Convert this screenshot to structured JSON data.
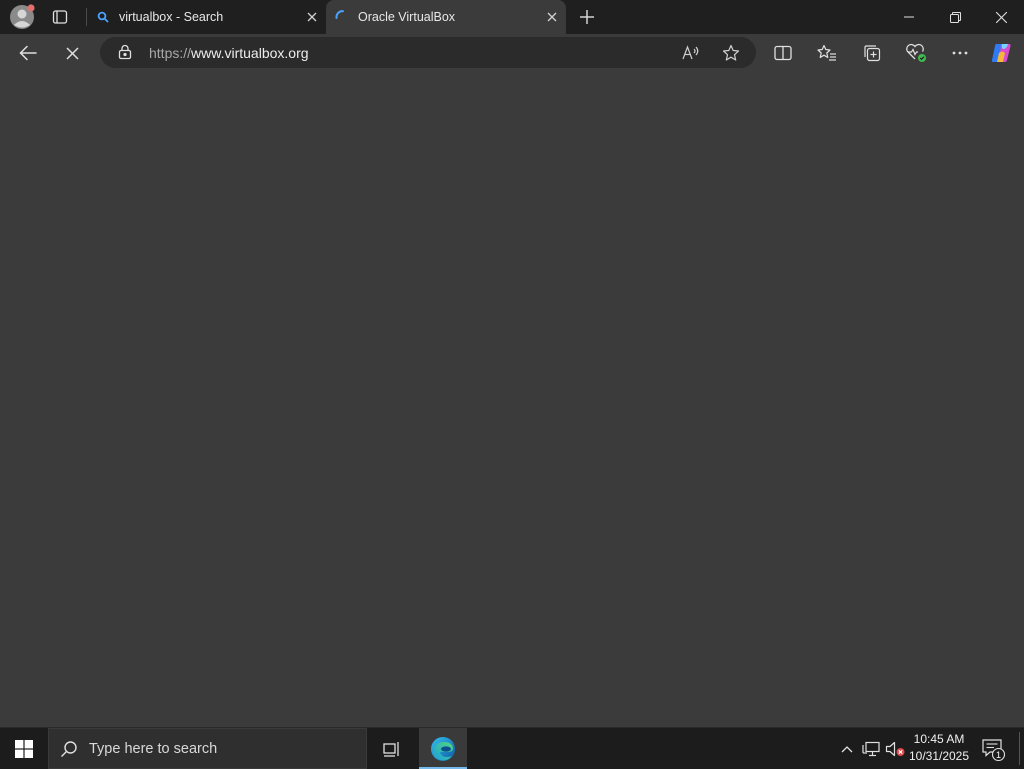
{
  "browser": {
    "tabs": [
      {
        "title": "virtualbox - Search",
        "icon": "search-icon",
        "active": false
      },
      {
        "title": "Oracle VirtualBox",
        "icon": "loading-spinner-icon",
        "active": true
      }
    ],
    "address": {
      "scheme": "https://",
      "host": "www.virtualbox.org"
    },
    "colors": {
      "tabstrip": "#1f1f1f",
      "toolbar": "#3b3b3b",
      "addressbar": "#2b2b2b",
      "accent": "#4aa3ff"
    }
  },
  "taskbar": {
    "search_placeholder": "Type here to search",
    "time": "10:45 AM",
    "date": "10/31/2025",
    "notification_count": "1",
    "colors": {
      "background": "#1c1c1c",
      "active_indicator": "#76b9ed"
    }
  }
}
